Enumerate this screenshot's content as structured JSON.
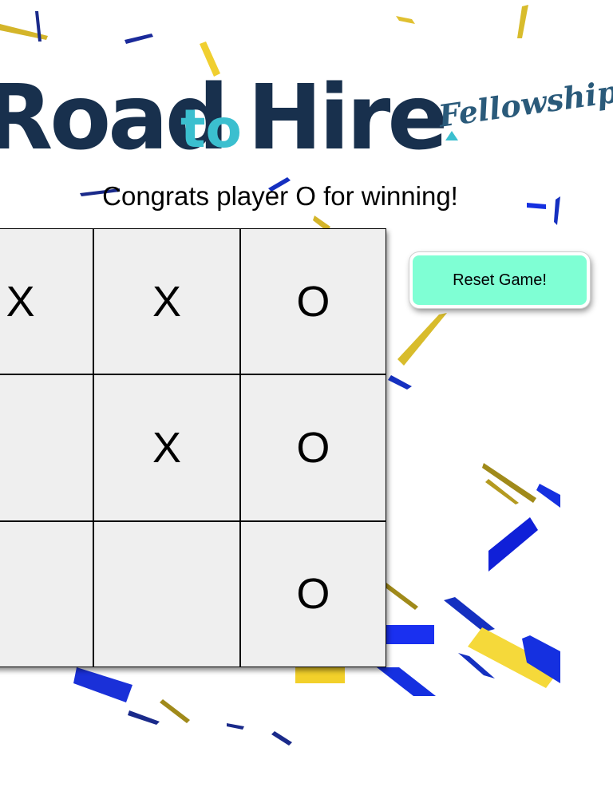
{
  "logo": {
    "road": "Road",
    "to": "to",
    "hire": "Hire",
    "fellowships": "Fellowships"
  },
  "status_message": "Congrats player O for winning!",
  "board": {
    "cells": [
      "X",
      "X",
      "O",
      "",
      "X",
      "O",
      "",
      "",
      "O"
    ]
  },
  "reset_button": {
    "label": "Reset Game!"
  },
  "colors": {
    "logo_navy": "#18304d",
    "logo_teal": "#3bbfcf",
    "cell_background": "#efefef",
    "reset_button": "#7fffd4",
    "confetti_blue": "#1530e0",
    "confetti_yellow": "#f2d02a"
  }
}
